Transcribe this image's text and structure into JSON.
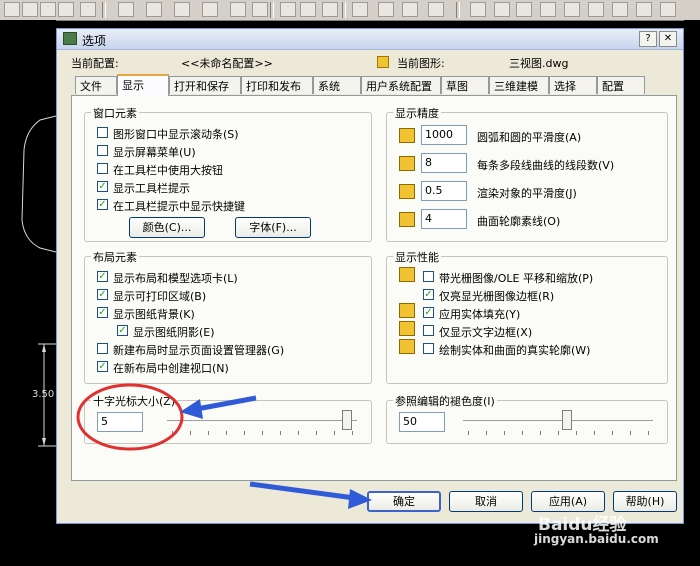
{
  "dialog": {
    "title": "选项",
    "help_button": "?",
    "close_button": "✕"
  },
  "header": {
    "current_profile_label": "当前配置:",
    "current_profile_value": "<<未命名配置>>",
    "current_drawing_label": "当前图形:",
    "current_drawing_value": "三视图.dwg"
  },
  "tabs": [
    "文件",
    "显示",
    "打开和保存",
    "打印和发布",
    "系统",
    "用户系统配置",
    "草图",
    "三维建模",
    "选择",
    "配置"
  ],
  "active_tab": "显示",
  "window_elements": {
    "title": "窗口元素",
    "items": [
      {
        "label": "图形窗口中显示滚动条(S)",
        "checked": false
      },
      {
        "label": "显示屏幕菜单(U)",
        "checked": false
      },
      {
        "label": "在工具栏中使用大按钮",
        "checked": false
      },
      {
        "label": "显示工具栏提示",
        "checked": true
      },
      {
        "label": "在工具栏提示中显示快捷键",
        "checked": true
      }
    ],
    "colors_button": "颜色(C)...",
    "fonts_button": "字体(F)..."
  },
  "display_resolution": {
    "title": "显示精度",
    "items": [
      {
        "value": "1000",
        "label": "圆弧和圆的平滑度(A)"
      },
      {
        "value": "8",
        "label": "每条多段线曲线的线段数(V)"
      },
      {
        "value": "0.5",
        "label": "渲染对象的平滑度(J)"
      },
      {
        "value": "4",
        "label": "曲面轮廓素线(O)"
      }
    ]
  },
  "layout_elements": {
    "title": "布局元素",
    "items": [
      {
        "label": "显示布局和模型选项卡(L)",
        "checked": true
      },
      {
        "label": "显示可打印区域(B)",
        "checked": true
      },
      {
        "label": "显示图纸背景(K)",
        "checked": true
      },
      {
        "label": "显示图纸阴影(E)",
        "checked": true
      },
      {
        "label": "新建布局时显示页面设置管理器(G)",
        "checked": false
      },
      {
        "label": "在新布局中创建视口(N)",
        "checked": true
      }
    ]
  },
  "display_performance": {
    "title": "显示性能",
    "items": [
      {
        "label": "带光栅图像/OLE 平移和缩放(P)",
        "checked": false
      },
      {
        "label": "仅亮显光栅图像边框(R)",
        "checked": true
      },
      {
        "label": "应用实体填充(Y)",
        "checked": true
      },
      {
        "label": "仅显示文字边框(X)",
        "checked": false
      },
      {
        "label": "绘制实体和曲面的真实轮廓(W)",
        "checked": false
      }
    ]
  },
  "crosshair": {
    "title": "十字光标大小(Z)",
    "value": "5",
    "slider_level": 0.97
  },
  "xref_fading": {
    "title": "参照编辑的褪色度(I)",
    "value": "50",
    "slider_level": 0.55
  },
  "footer": {
    "ok": "确定",
    "cancel": "取消",
    "apply": "应用(A)",
    "help": "帮助(H)"
  },
  "background": {
    "dimension_text": "3.50"
  },
  "watermark": {
    "brand": "Baidu经验",
    "url": "jingyan.baidu.com"
  },
  "annotation_colors": {
    "circle": "#e03030",
    "arrow": "#2f5bd8"
  }
}
